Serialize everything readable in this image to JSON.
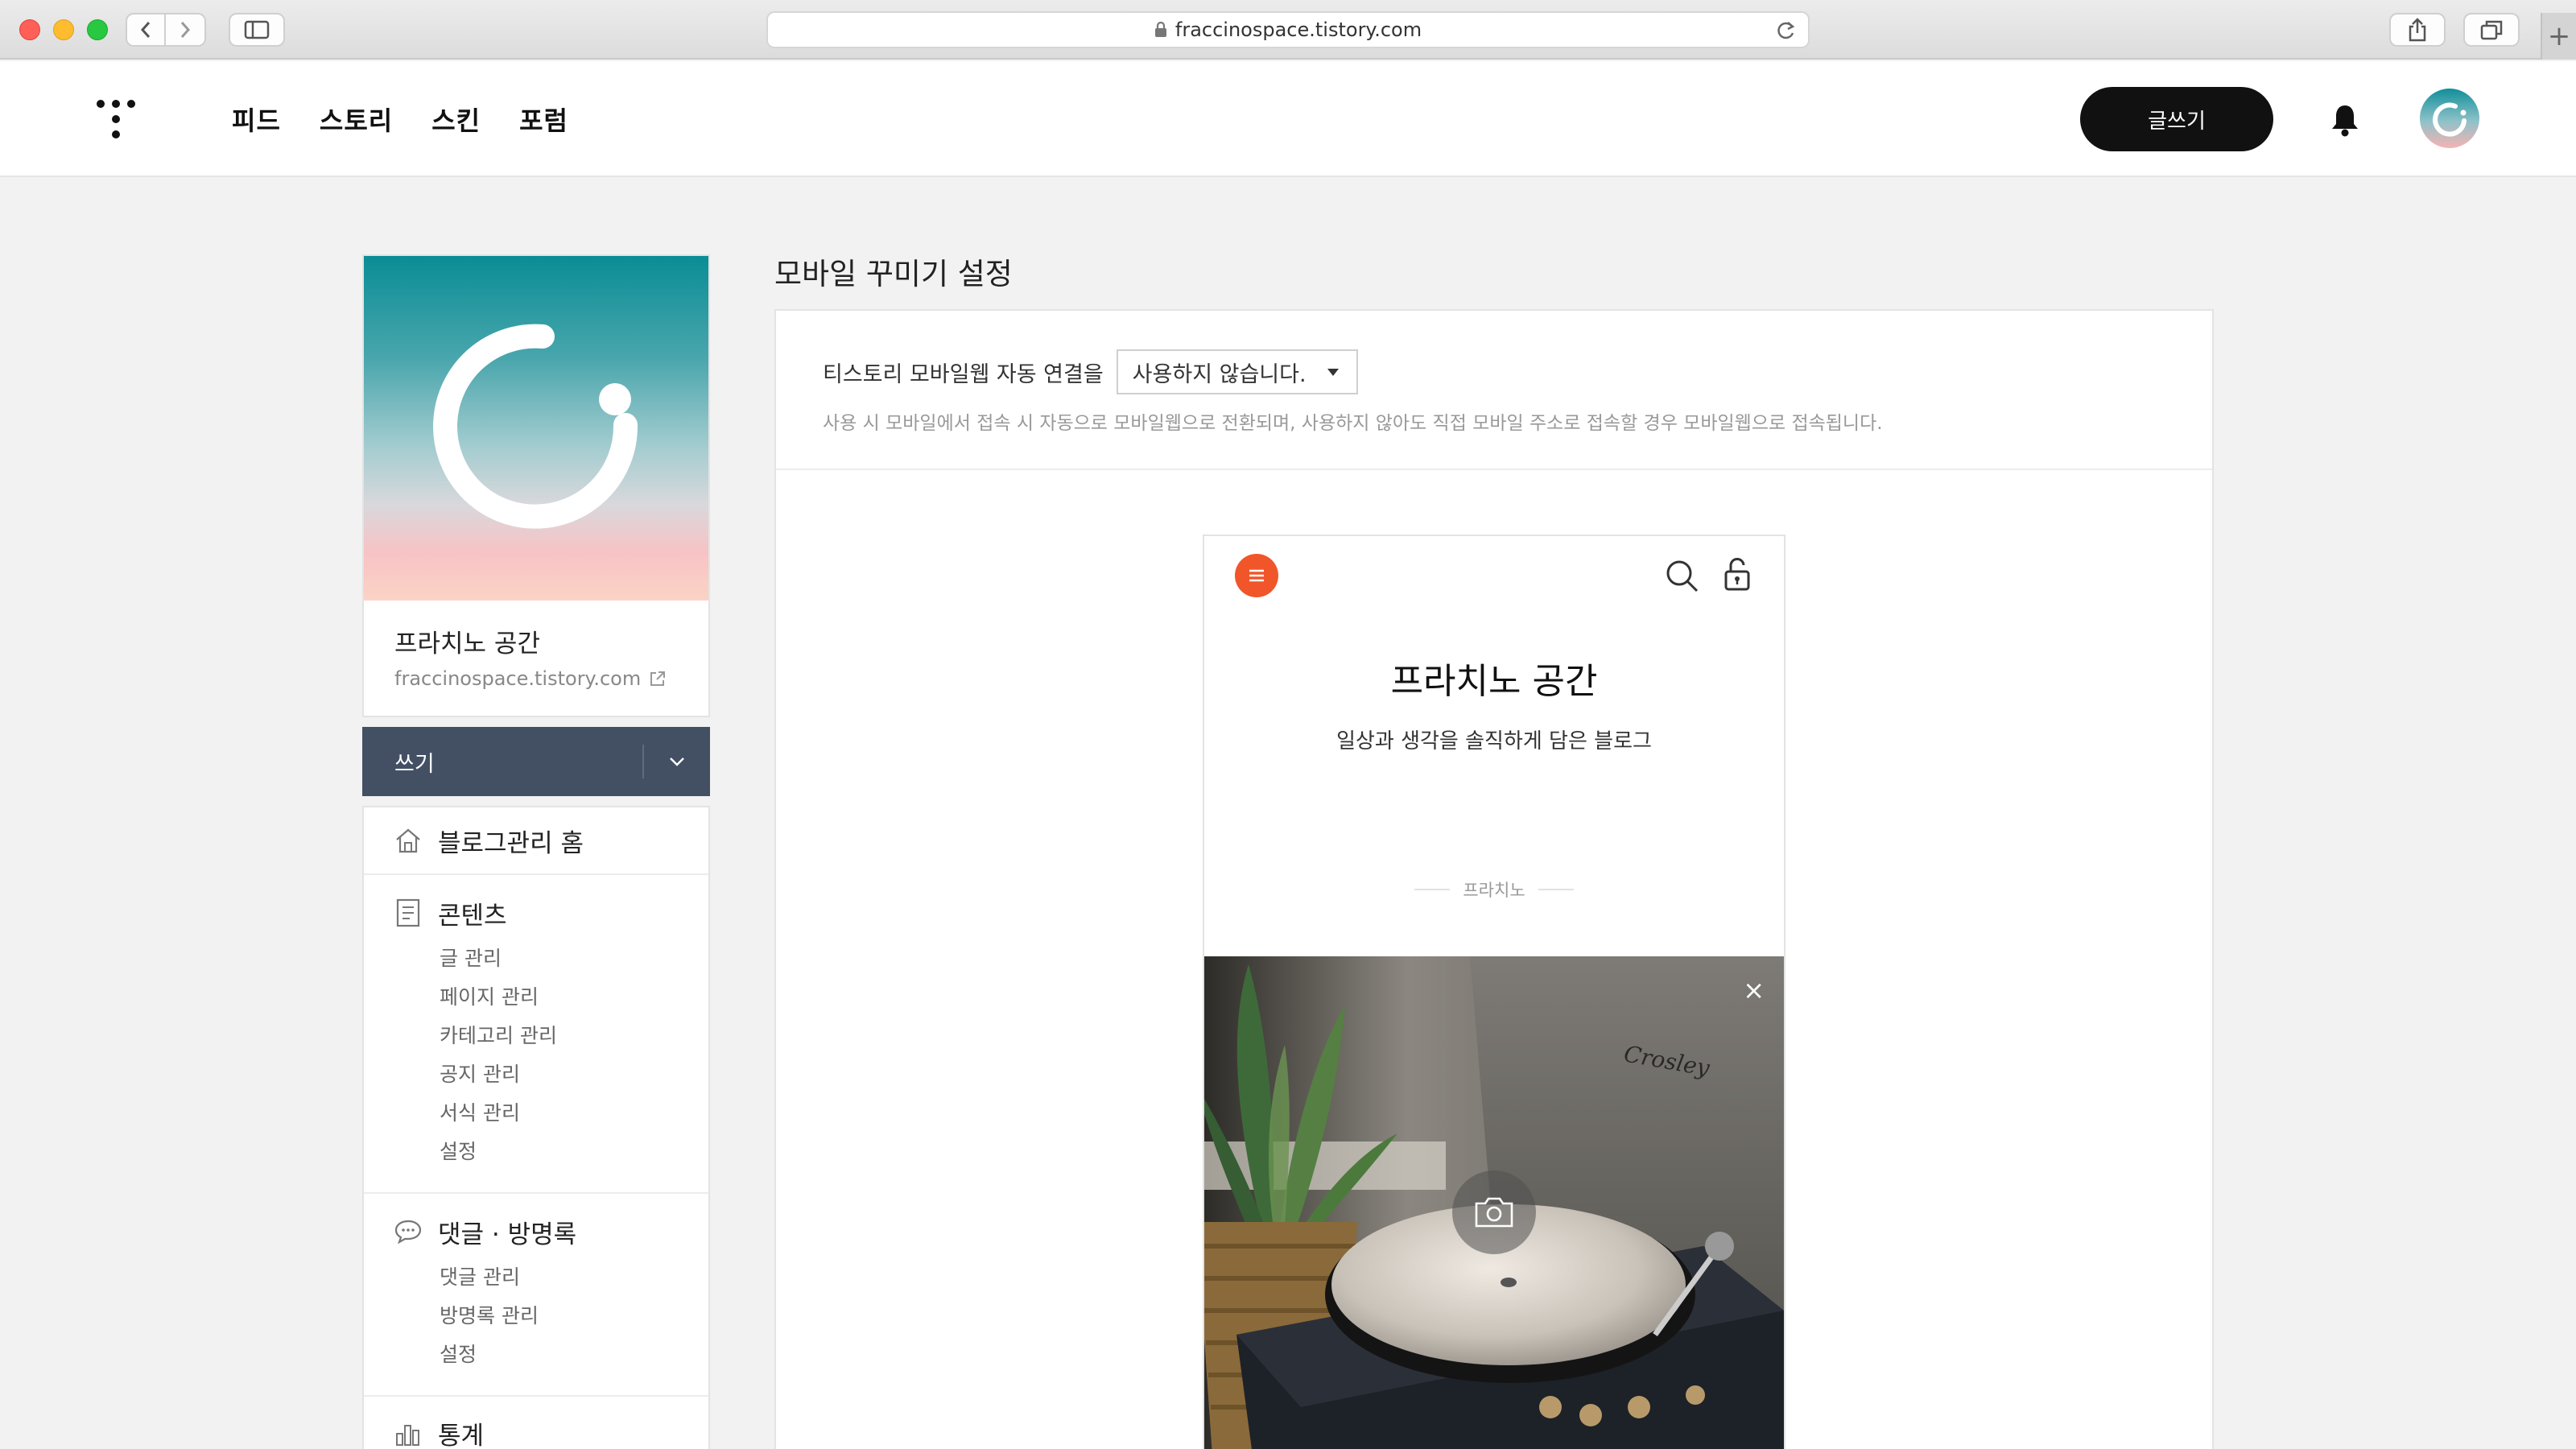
{
  "browser": {
    "url": "fraccinospace.tistory.com"
  },
  "topnav": {
    "links": [
      "피드",
      "스토리",
      "스킨",
      "포럼"
    ],
    "write_label": "글쓰기"
  },
  "sidebar": {
    "blog_name": "프라치노 공간",
    "blog_url": "fraccinospace.tistory.com",
    "write_label": "쓰기",
    "home_label": "블로그관리 홈",
    "contents": {
      "label": "콘텐츠",
      "items": [
        "글 관리",
        "페이지 관리",
        "카테고리 관리",
        "공지 관리",
        "서식 관리",
        "설정"
      ]
    },
    "comments": {
      "label": "댓글 · 방명록",
      "items": [
        "댓글 관리",
        "방명록 관리",
        "설정"
      ]
    },
    "stats": {
      "label": "통계"
    }
  },
  "main": {
    "title": "모바일 꾸미기 설정",
    "setting_label": "티스토리 모바일웹 자동 연결을",
    "setting_value": "사용하지 않습니다.",
    "setting_desc": "사용 시 모바일에서 접속 시 자동으로 모바일웹으로 전환되며, 사용하지 않아도 직접 모바일 주소로 접속할 경우 모바일웹으로 접속됩니다."
  },
  "preview": {
    "title": "프라치노 공간",
    "description": "일상과 생각을 솔직하게 담은 블로그",
    "author": "프라치노",
    "close_glyph": "×",
    "image_brand": "Crosley"
  },
  "colors": {
    "accent_orange": "#f0562a",
    "sidebar_dark": "#435064",
    "teal": "#0a8d95"
  }
}
